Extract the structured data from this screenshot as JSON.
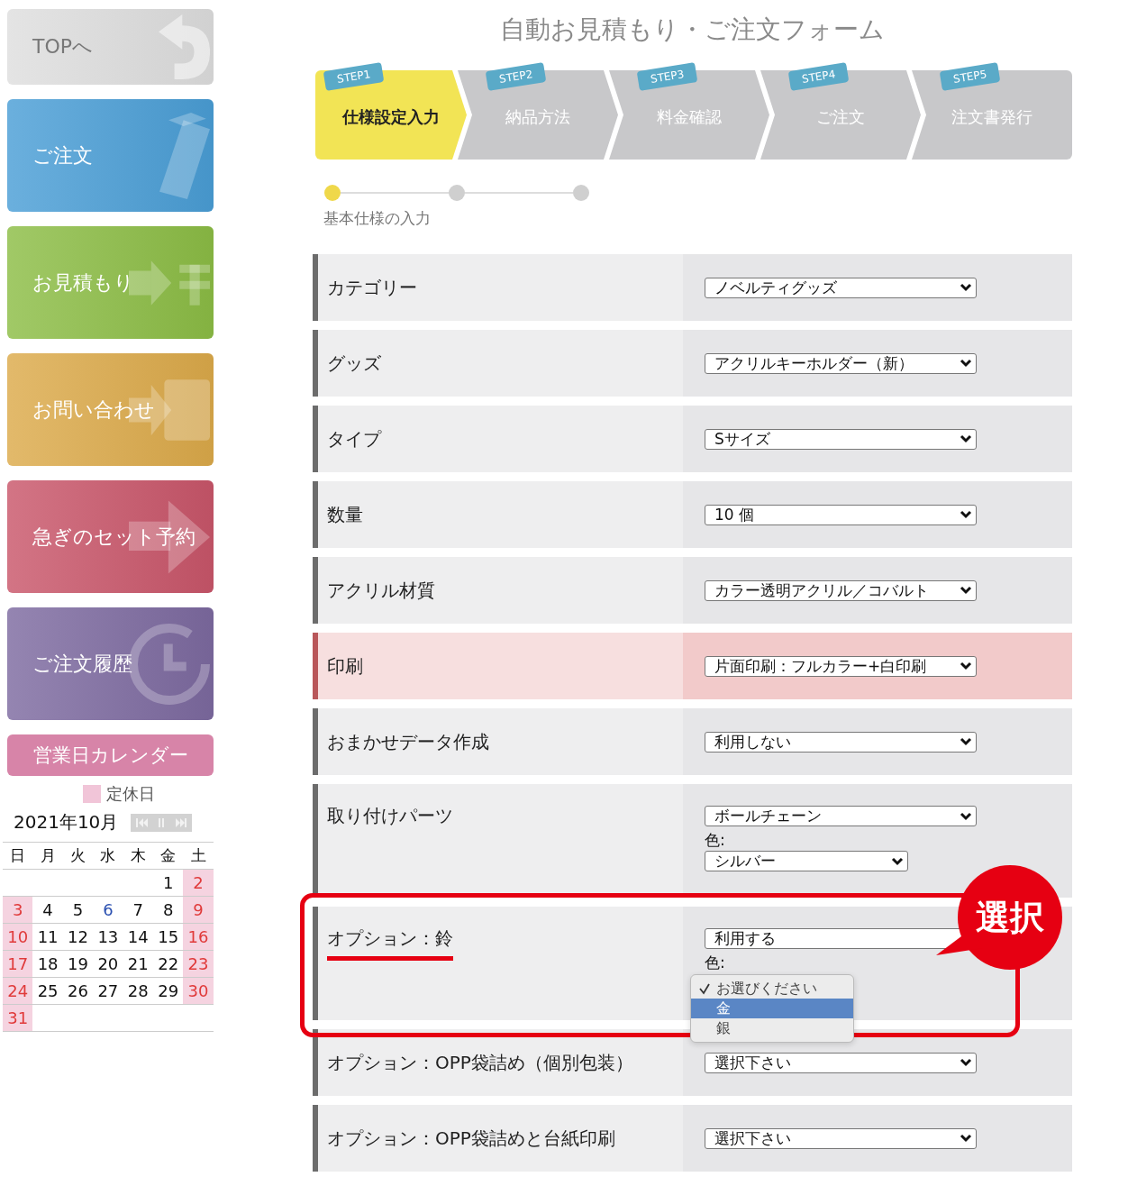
{
  "sidebar": {
    "buttons": [
      {
        "label": "TOPへ",
        "color": "#dedede"
      },
      {
        "label": "ご注文",
        "color": "#4a9ed6"
      },
      {
        "label": "お見積もり",
        "color": "#8cbd45"
      },
      {
        "label": "お問い合わせ",
        "color": "#dcaa4a"
      },
      {
        "label": "急ぎのセット予約",
        "color": "#c9566a"
      },
      {
        "label": "ご注文履歴",
        "color": "#7d6aa0"
      }
    ],
    "calendar": {
      "title": "営業日カレンダー",
      "legend": "定休日",
      "month": "2021年10月",
      "weekdays": [
        "日",
        "月",
        "火",
        "水",
        "木",
        "金",
        "土"
      ],
      "weeks": [
        [
          {
            "day": "1",
            "kind": "weekday"
          },
          {
            "day": "2",
            "kind": "holiday"
          }
        ],
        [
          {
            "day": "3",
            "kind": "holiday"
          },
          {
            "day": "4",
            "kind": "weekday"
          },
          {
            "day": "5",
            "kind": "weekday"
          },
          {
            "day": "6",
            "kind": "marked"
          },
          {
            "day": "7",
            "kind": "weekday"
          },
          {
            "day": "8",
            "kind": "weekday"
          },
          {
            "day": "9",
            "kind": "holiday"
          }
        ],
        [
          {
            "day": "10",
            "kind": "holiday"
          },
          {
            "day": "11",
            "kind": "weekday"
          },
          {
            "day": "12",
            "kind": "weekday"
          },
          {
            "day": "13",
            "kind": "weekday"
          },
          {
            "day": "14",
            "kind": "weekday"
          },
          {
            "day": "15",
            "kind": "weekday"
          },
          {
            "day": "16",
            "kind": "holiday"
          }
        ],
        [
          {
            "day": "17",
            "kind": "holiday"
          },
          {
            "day": "18",
            "kind": "weekday"
          },
          {
            "day": "19",
            "kind": "weekday"
          },
          {
            "day": "20",
            "kind": "weekday"
          },
          {
            "day": "21",
            "kind": "weekday"
          },
          {
            "day": "22",
            "kind": "weekday"
          },
          {
            "day": "23",
            "kind": "holiday"
          }
        ],
        [
          {
            "day": "24",
            "kind": "holiday"
          },
          {
            "day": "25",
            "kind": "weekday"
          },
          {
            "day": "26",
            "kind": "weekday"
          },
          {
            "day": "27",
            "kind": "weekday"
          },
          {
            "day": "28",
            "kind": "weekday"
          },
          {
            "day": "29",
            "kind": "weekday"
          },
          {
            "day": "30",
            "kind": "holiday"
          }
        ],
        [
          {
            "day": "31",
            "kind": "holiday"
          }
        ]
      ]
    }
  },
  "form": {
    "title": "自動お見積もり・ご注文フォーム",
    "steps": [
      {
        "badge": "STEP1",
        "label": "仕様設定入力",
        "selected": true
      },
      {
        "badge": "STEP2",
        "label": "納品方法",
        "selected": false
      },
      {
        "badge": "STEP3",
        "label": "料金確認",
        "selected": false
      },
      {
        "badge": "STEP4",
        "label": "ご注文",
        "selected": false
      },
      {
        "badge": "STEP5",
        "label": "注文書発行",
        "selected": false
      }
    ],
    "progress": {
      "dots": [
        {
          "selected": true
        },
        {
          "selected": false
        },
        {
          "selected": false
        }
      ],
      "caption": "基本仕様の入力"
    },
    "rows": [
      {
        "label": "カテゴリー",
        "highlighted": false,
        "underlined": false,
        "fields": [
          {
            "kind": "select",
            "value": "ノベルティグッズ"
          }
        ]
      },
      {
        "label": "グッズ",
        "highlighted": false,
        "underlined": false,
        "fields": [
          {
            "kind": "select",
            "value": "アクリルキーホルダー（新）"
          }
        ]
      },
      {
        "label": "タイプ",
        "highlighted": false,
        "underlined": false,
        "fields": [
          {
            "kind": "select",
            "value": "Sサイズ"
          }
        ]
      },
      {
        "label": "数量",
        "highlighted": false,
        "underlined": false,
        "fields": [
          {
            "kind": "select",
            "value": "10 個"
          }
        ]
      },
      {
        "label": "アクリル材質",
        "highlighted": false,
        "underlined": false,
        "fields": [
          {
            "kind": "select",
            "value": "カラー透明アクリル／コバルト"
          }
        ]
      },
      {
        "label": "印刷",
        "highlighted": true,
        "underlined": false,
        "fields": [
          {
            "kind": "select",
            "value": "片面印刷：フルカラー+白印刷"
          }
        ]
      },
      {
        "label": "おまかせデータ作成",
        "highlighted": false,
        "underlined": false,
        "fields": [
          {
            "kind": "select",
            "value": "利用しない"
          }
        ]
      },
      {
        "label": "取り付けパーツ",
        "highlighted": false,
        "underlined": false,
        "fields": [
          {
            "kind": "select",
            "value": "ボールチェーン"
          },
          {
            "kind": "caption",
            "value": "色:"
          },
          {
            "kind": "small-select",
            "value": "シルバー"
          }
        ]
      },
      {
        "label": "オプション：鈴",
        "highlighted": false,
        "underlined": true,
        "callout": "選択",
        "fields": [
          {
            "kind": "select",
            "value": "利用する"
          },
          {
            "kind": "caption",
            "value": "色:"
          },
          {
            "kind": "dropdown",
            "options": [
              {
                "label": "お選びください",
                "checked": true,
                "selected": false
              },
              {
                "label": "金",
                "checked": false,
                "selected": true
              },
              {
                "label": "銀",
                "checked": false,
                "selected": false
              }
            ]
          }
        ]
      },
      {
        "label": "オプション：OPP袋詰め（個別包装）",
        "highlighted": false,
        "underlined": false,
        "fields": [
          {
            "kind": "select",
            "value": "選択下さい"
          }
        ]
      },
      {
        "label": "オプション：OPP袋詰めと台紙印刷",
        "highlighted": false,
        "underlined": false,
        "fields": [
          {
            "kind": "select",
            "value": "選択下さい"
          }
        ]
      }
    ]
  }
}
